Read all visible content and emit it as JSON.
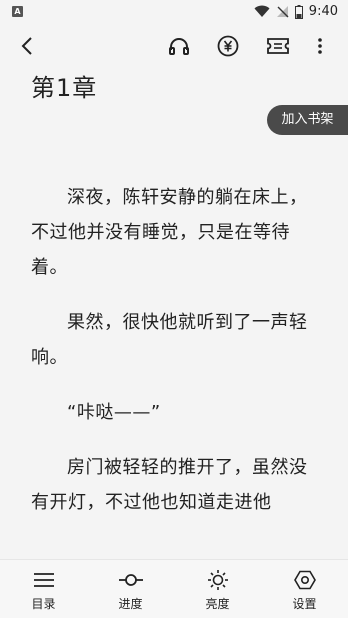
{
  "status_bar": {
    "notification_icon": "A",
    "time": "9:40"
  },
  "toolbar": {
    "back": "back-icon",
    "listen": "headphones-icon",
    "reward": "yuan-icon",
    "ticket": "ticket-icon",
    "more": "more-icon"
  },
  "chapter": {
    "title": "第1章"
  },
  "shelf_button": "加入书架",
  "paragraphs": [
    "深夜，陈轩安静的躺在床上，不过他并没有睡觉，只是在等待着。",
    "果然，很快他就听到了一声轻响。",
    "“咔哒——”",
    "房门被轻轻的推开了，虽然没有开灯，不过他也知道走进他"
  ],
  "bottom_nav": [
    {
      "label": "目录",
      "icon": "menu-icon"
    },
    {
      "label": "进度",
      "icon": "progress-icon"
    },
    {
      "label": "亮度",
      "icon": "brightness-icon"
    },
    {
      "label": "设置",
      "icon": "settings-icon"
    }
  ]
}
